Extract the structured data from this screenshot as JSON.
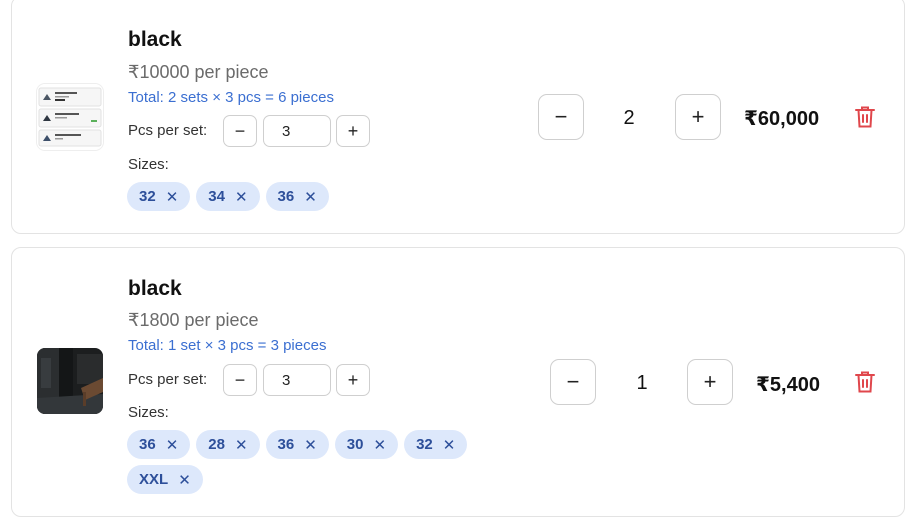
{
  "cart": {
    "items": [
      {
        "title": "black",
        "price": "₹10000 per piece",
        "total": "Total: 2 sets × 3 pcs = 6 pieces",
        "pcs_label": "Pcs per set:",
        "pcs_value": "3",
        "pcs_minus": "−",
        "pcs_plus": "+",
        "sizes_label": "Sizes:",
        "sizes": [
          "32",
          "34",
          "36"
        ],
        "qty_minus": "−",
        "qty": "2",
        "qty_plus": "+",
        "line_total": "₹60,000",
        "icons": {
          "remove": "trash-icon",
          "chip_remove": "close-icon"
        }
      },
      {
        "title": "black",
        "price": "₹1800 per piece",
        "total": "Total: 1 set × 3 pcs = 3 pieces",
        "pcs_label": "Pcs per set:",
        "pcs_value": "3",
        "pcs_minus": "−",
        "pcs_plus": "+",
        "sizes_label": "Sizes:",
        "sizes": [
          "36",
          "28",
          "36",
          "30",
          "32",
          "XXL"
        ],
        "qty_minus": "−",
        "qty": "1",
        "qty_plus": "+",
        "line_total": "₹5,400",
        "icons": {
          "remove": "trash-icon",
          "chip_remove": "close-icon"
        }
      }
    ],
    "colors": {
      "accent": "#3b6fd1",
      "chip_bg": "#dde8fb",
      "chip_text": "#2d4f9a",
      "danger": "#e0474c"
    }
  }
}
